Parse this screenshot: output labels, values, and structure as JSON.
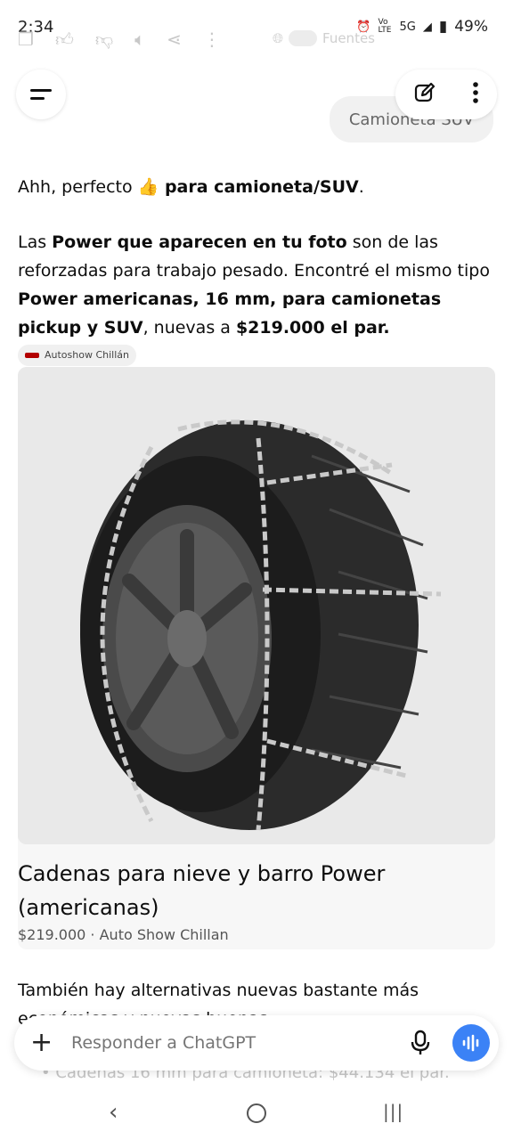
{
  "status": {
    "time": "2:34",
    "network": "5G",
    "volte": "Vo LTE",
    "battery": "49%"
  },
  "ghost": {
    "sources": "Fuentes"
  },
  "user_message": "Camioneta SUV",
  "reply": {
    "p1_a": "Ahh, perfecto ",
    "p1_emoji": "👍",
    "p1_b": " para camioneta/SUV",
    "p1_c": ".",
    "p2_a": "Las ",
    "p2_b": "Power que aparecen en tu foto",
    "p2_c": " son de las reforzadas para trabajo pesado. Encontré el mismo tipo ",
    "p2_d": "Power americanas, 16 mm, para camionetas pickup y SUV",
    "p2_e": ", nuevas a ",
    "p2_f": "$219.000 el par.",
    "source_badge": "Autoshow Chillán",
    "p3": "También hay alternativas nuevas bastante más económicas y nuevas buenas:"
  },
  "card": {
    "title": "Cadenas para nieve y barro Power (americanas)",
    "meta": "$219.000 · Auto Show Chillan"
  },
  "ghost_bullet": "Cadenas 16 mm para camioneta: $44.134 el par.",
  "composer": {
    "placeholder": "Responder a ChatGPT"
  },
  "colors": {
    "accent": "#3b82f6",
    "text": "#0d0d0d"
  }
}
